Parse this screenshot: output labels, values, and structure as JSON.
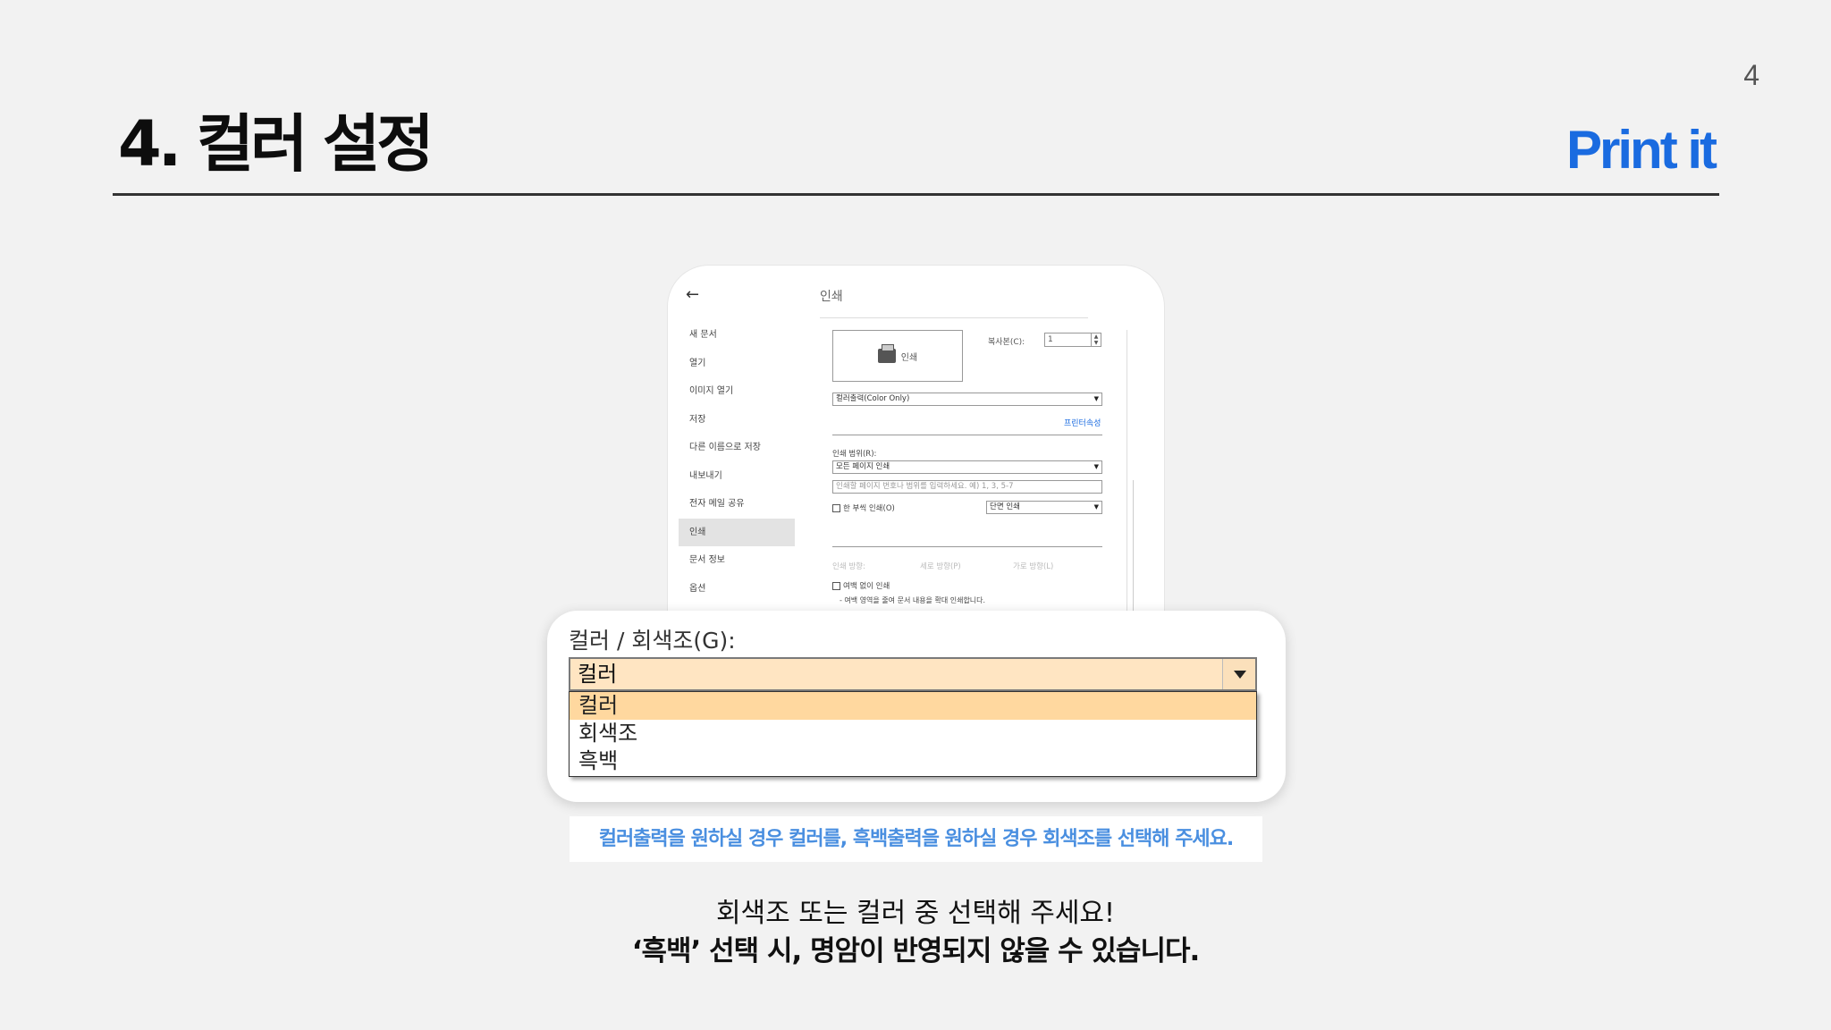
{
  "slide": {
    "page_number": "4",
    "title": "4. 컬러 설정",
    "brand": "Print it"
  },
  "dialog": {
    "back_icon": "arrow-left-icon",
    "heading": "인쇄",
    "menu": [
      "새 문서",
      "열기",
      "이미지 열기",
      "저장",
      "다른 이름으로 저장",
      "내보내기",
      "전자 메일 공유",
      "인쇄",
      "문서 정보",
      "옵션"
    ],
    "active_menu": "인쇄",
    "print_button": "인쇄",
    "copies_label": "복사본(C):",
    "copies_value": "1",
    "printer_select": "컬러출력(Color Only)",
    "printer_properties": "프린터속성",
    "range_label": "인쇄 범위(R):",
    "range_select": "모든 페이지 인쇄",
    "range_placeholder": "인쇄할 페이지 번호나 범위를 입력하세요. 예) 1, 3, 5-7",
    "collate_label": "한 부씩 인쇄(O)",
    "sides_select": "단면 인쇄",
    "orientation_label": "인쇄 방향:",
    "portrait_label": "세로 방향(P)",
    "landscape_label": "가로 방향(L)",
    "borderless_label": "여백 없이 인쇄",
    "borderless_note": "- 여백 영역을 줄여 문서 내용을 확대 인쇄합니다."
  },
  "zoom": {
    "label": "컬러 / 회색조(G):",
    "current_value": "컬러",
    "options": [
      "컬러",
      "회색조",
      "흑백"
    ]
  },
  "caption": "컬러출력을 원하실 경우 컬러를, 흑백출력을 원하실 경우 회색조를 선택해 주세요.",
  "notes": {
    "line1": "회색조 또는 컬러 중 선택해 주세요!",
    "line2": "‘흑백’ 선택 시, 명암이 반영되지 않을 수 있습니다."
  },
  "colors": {
    "brand": "#1a6be0",
    "caption": "#4a8fe0",
    "highlight": "#ffd89f"
  }
}
